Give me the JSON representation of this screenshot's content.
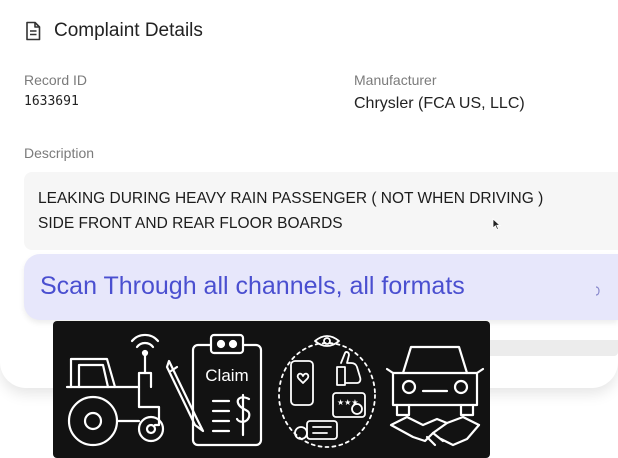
{
  "header": {
    "title": "Complaint Details",
    "icon": "document-icon"
  },
  "fields": {
    "record_id": {
      "label": "Record ID",
      "value": "1633691"
    },
    "manufacturer": {
      "label": "Manufacturer",
      "value": "Chrysler (FCA US, LLC)"
    },
    "description": {
      "label": "Description",
      "value": "LEAKING DURING HEAVY RAIN PASSENGER ( NOT WHEN DRIVING )\nSIDE FRONT AND REAR FLOOR BOARDS"
    }
  },
  "banner": {
    "text": "Scan Through all channels, all formats",
    "color": "#4a4fd0",
    "background": "#e7e7fb"
  },
  "illustration": {
    "items": [
      {
        "icon": "tractor-icon"
      },
      {
        "icon": "claim-form-icon",
        "label": "Claim"
      },
      {
        "icon": "social-feedback-icon"
      },
      {
        "icon": "car-handshake-icon"
      }
    ]
  }
}
